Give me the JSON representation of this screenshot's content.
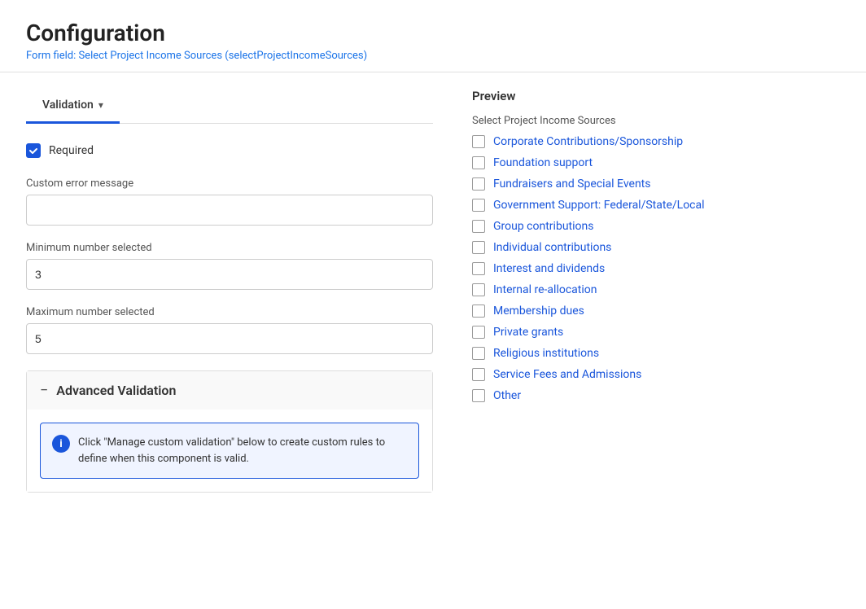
{
  "header": {
    "title": "Configuration",
    "subtitle": "Form field: Select Project Income Sources (",
    "subtitle_code": "selectProjectIncomeSources",
    "subtitle_end": ")"
  },
  "tabs": [
    {
      "label": "Validation",
      "active": true
    }
  ],
  "form": {
    "required_label": "Required",
    "required_checked": true,
    "custom_error_label": "Custom error message",
    "custom_error_value": "",
    "min_label": "Minimum number selected",
    "min_value": "3",
    "max_label": "Maximum number selected",
    "max_value": "5",
    "advanced_title": "Advanced Validation",
    "info_text": "Click \"Manage custom validation\" below to create custom rules to define when this component is valid."
  },
  "preview": {
    "section_title": "Preview",
    "field_label": "Select Project Income Sources",
    "options": [
      "Corporate Contributions/Sponsorship",
      "Foundation support",
      "Fundraisers and Special Events",
      "Government Support: Federal/State/Local",
      "Group contributions",
      "Individual contributions",
      "Interest and dividends",
      "Internal re-allocation",
      "Membership dues",
      "Private grants",
      "Religious institutions",
      "Service Fees and Admissions",
      "Other"
    ]
  },
  "icons": {
    "chevron_down": "▾",
    "minus": "−",
    "info": "i",
    "checkmark": "✓"
  }
}
